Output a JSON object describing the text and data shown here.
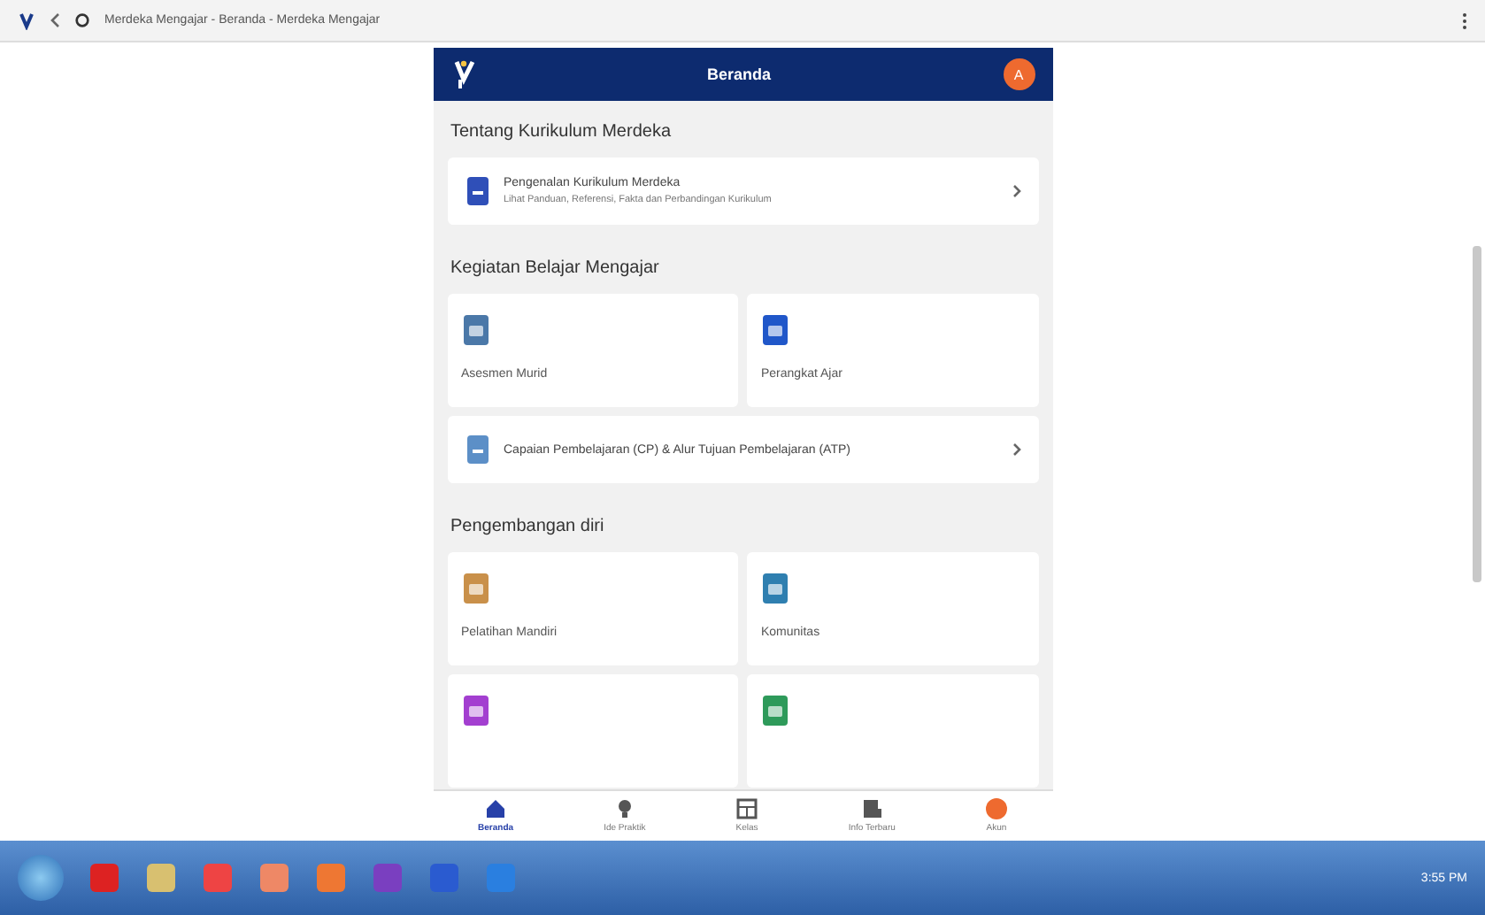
{
  "browser": {
    "tab_title": "Merdeka Mengajar - Beranda - Merdeka Mengajar"
  },
  "app_bar": {
    "title": "Beranda",
    "avatar": "A"
  },
  "sections": [
    {
      "title": "Tentang Kurikulum Merdeka",
      "items": [
        {
          "kind": "row",
          "title": "Pengenalan Kurikulum Merdeka",
          "subtitle": "Lihat Panduan, Referensi, Fakta dan Perbandingan Kurikulum"
        }
      ]
    },
    {
      "title": "Kegiatan Belajar Mengajar",
      "items": [
        {
          "kind": "tile",
          "title": "Asesmen Murid"
        },
        {
          "kind": "tile",
          "title": "Perangkat Ajar"
        },
        {
          "kind": "row",
          "title": "Capaian Pembelajaran (CP) & Alur Tujuan Pembelajaran (ATP)"
        }
      ]
    },
    {
      "title": "Pengembangan diri",
      "items": [
        {
          "kind": "tile",
          "title": "Pelatihan Mandiri"
        },
        {
          "kind": "tile",
          "title": "Komunitas"
        },
        {
          "kind": "tile"
        },
        {
          "kind": "tile"
        }
      ]
    }
  ],
  "bottom_nav": [
    {
      "label": "Beranda",
      "selected": true
    },
    {
      "label": "Ide Praktik",
      "selected": false
    },
    {
      "label": "Kelas",
      "selected": false
    },
    {
      "label": "Info Terbaru",
      "selected": false
    },
    {
      "label": "Akun",
      "selected": false
    }
  ],
  "taskbar": {
    "clock": "3:55 PM"
  }
}
